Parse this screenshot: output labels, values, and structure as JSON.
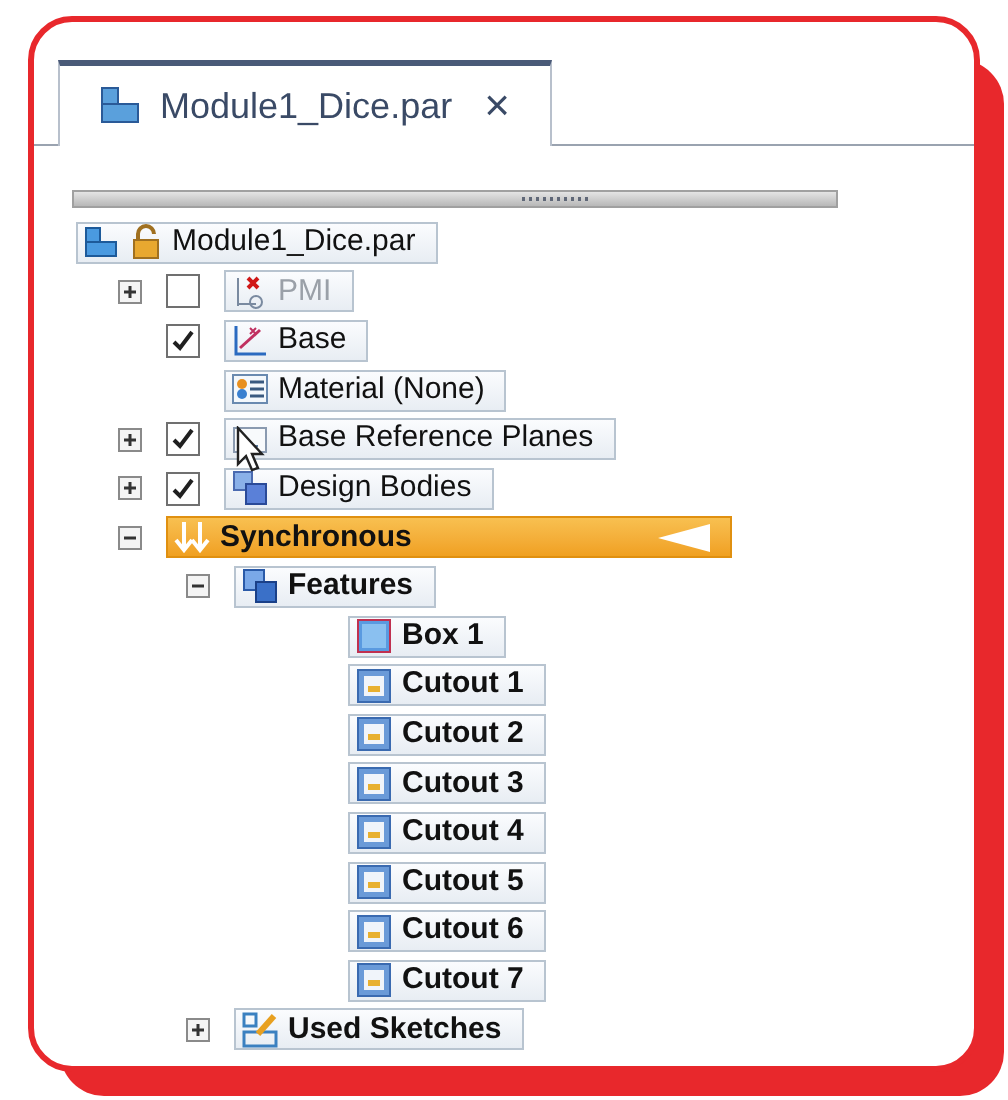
{
  "tab": {
    "title": "Module1_Dice.par",
    "close": "×"
  },
  "tree": {
    "label": "Module1_Dice.par",
    "kind": "part",
    "selected": false,
    "disabled": false,
    "children": [
      {
        "label": "PMI",
        "kind": "pmi",
        "expanded": false,
        "checked": false,
        "disabled": true,
        "selected": false
      },
      {
        "label": "Base",
        "kind": "sketch",
        "checked": true,
        "disabled": false,
        "selected": false
      },
      {
        "label": "Material (None)",
        "kind": "material",
        "disabled": false,
        "selected": false
      },
      {
        "label": "Base Reference Planes",
        "kind": "planes",
        "expanded": false,
        "checked": true,
        "disabled": false,
        "selected": false
      },
      {
        "label": "Design Bodies",
        "kind": "bodies",
        "expanded": false,
        "checked": true,
        "disabled": false,
        "selected": false
      },
      {
        "label": "Synchronous",
        "kind": "synchronous",
        "expanded": true,
        "disabled": false,
        "selected": true,
        "children": [
          {
            "label": "Features",
            "kind": "features",
            "expanded": true,
            "disabled": false,
            "selected": false,
            "children": [
              {
                "label": "Box 1",
                "kind": "box",
                "disabled": false,
                "selected": false
              },
              {
                "label": "Cutout 1",
                "kind": "cutout",
                "disabled": false,
                "selected": false
              },
              {
                "label": "Cutout 2",
                "kind": "cutout",
                "disabled": false,
                "selected": false
              },
              {
                "label": "Cutout 3",
                "kind": "cutout",
                "disabled": false,
                "selected": false
              },
              {
                "label": "Cutout 4",
                "kind": "cutout",
                "disabled": false,
                "selected": false
              },
              {
                "label": "Cutout 5",
                "kind": "cutout",
                "disabled": false,
                "selected": false
              },
              {
                "label": "Cutout 6",
                "kind": "cutout",
                "disabled": false,
                "selected": false
              },
              {
                "label": "Cutout 7",
                "kind": "cutout",
                "disabled": false,
                "selected": false
              }
            ]
          },
          {
            "label": "Used Sketches",
            "kind": "sketches",
            "expanded": false,
            "disabled": false,
            "selected": false
          }
        ]
      }
    ]
  }
}
